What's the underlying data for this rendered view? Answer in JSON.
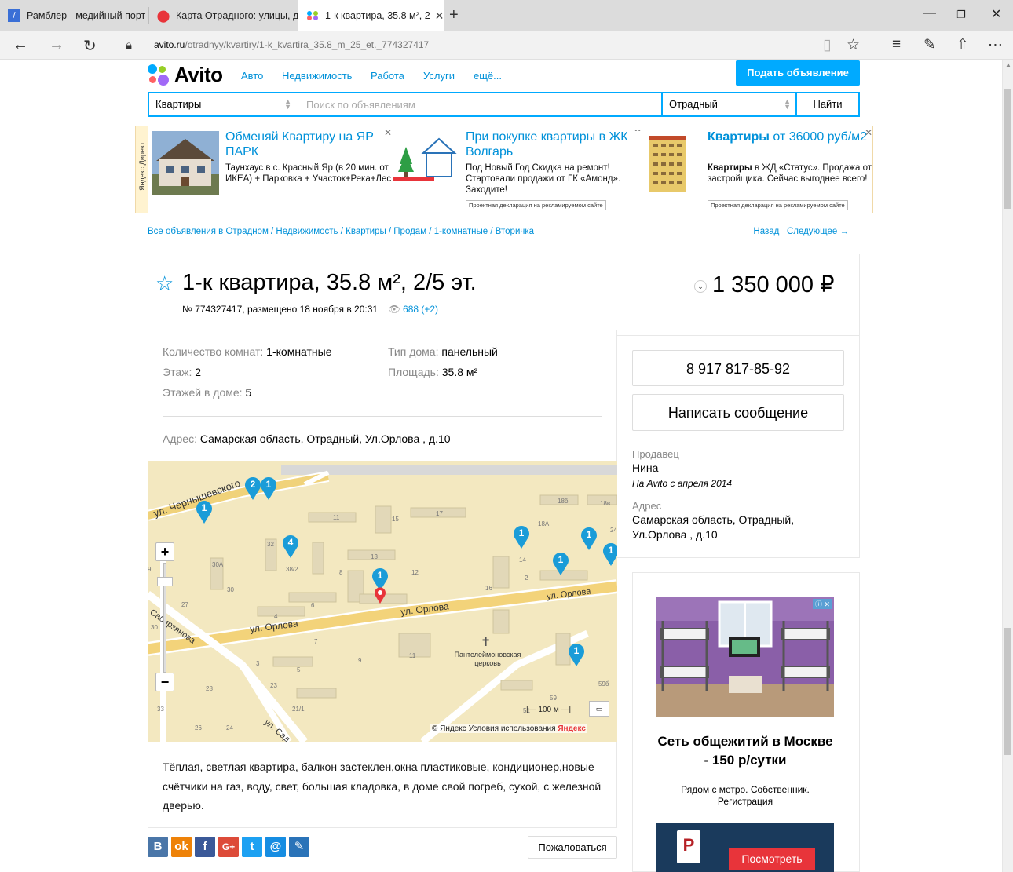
{
  "browser": {
    "tabs": [
      {
        "title": "Рамблер - медийный порт",
        "active": false
      },
      {
        "title": "Карта Отрадного: улицы, д",
        "active": false
      },
      {
        "title": "1-к квартира, 35.8 м², 2",
        "active": true
      }
    ],
    "url_domain": "avito.ru",
    "url_path": "/otradnyy/kvartiry/1-k_kvartira_35.8_m_25_et._774327417"
  },
  "header": {
    "logo": "Avito",
    "nav": [
      "Авто",
      "Недвижимость",
      "Работа",
      "Услуги",
      "ещё..."
    ],
    "post_button": "Подать объявление"
  },
  "search": {
    "category": "Квартиры",
    "placeholder": "Поиск по объявлениям",
    "city": "Отрадный",
    "button": "Найти"
  },
  "ads": {
    "label": "Яндекс.Директ",
    "items": [
      {
        "title": "Обменяй Квартиру на ЯР ПАРК",
        "text": "Таунхаус в с. Красный Яр (в 20 мин. от ИКЕА) + Парковка + Участок+Река+Лес",
        "note": ""
      },
      {
        "title": "При покупке квартиры в ЖК Волгарь",
        "text": "Под Новый Год Скидка на ремонт! Стартовали продажи от ГК «Амонд». Заходите!",
        "note": "Проектная декларация на рекламируемом сайте"
      },
      {
        "title_bold": "Квартиры",
        "title": " от 36000 руб/м2",
        "text_bold": "Квартиры",
        "text": " в ЖД «Статус». Продажа от застройщика. Сейчас выгоднее всего!",
        "note": "Проектная декларация на рекламируемом сайте"
      }
    ]
  },
  "breadcrumbs": "Все объявления в Отрадном / Недвижимость / Квартиры / Продам / 1-комнатные / Вторичка",
  "nav_back": "Назад",
  "nav_next": "Следующее →",
  "listing": {
    "title": "1-к квартира, 35.8 м², 2/5 эт.",
    "meta": "№ 774327417, размещено 18 ноября в 20:31",
    "views": "688 (+2)",
    "price": "1 350 000 ₽",
    "params": [
      {
        "label": "Количество комнат:",
        "value": "1-комнатные"
      },
      {
        "label": "Тип дома:",
        "value": "панельный"
      },
      {
        "label": "Этаж:",
        "value": "2"
      },
      {
        "label": "Площадь:",
        "value": "35.8 м²"
      },
      {
        "label": "Этажей в доме:",
        "value": "5"
      }
    ],
    "address_label": "Адрес:",
    "address": "Самарская область, Отрадный, Ул.Орлова , д.10",
    "description": "Тёплая, светлая квартира, балкон застеклен,окна пластиковые, кондиционер,новые счётчики на газ, воду, свет, большая кладовка, в доме свой погреб, сухой, с железной дверью.",
    "report_button": "Пожаловаться"
  },
  "map": {
    "streets": [
      "ул. Чернышевского",
      "ул. Орлова",
      "ул. Орлова",
      "ул. Орлова",
      "Сабирзянова",
      "ул. Сад"
    ],
    "church": "Пантелеймоновская церковь",
    "scale": "100 м",
    "copyright": "© Яндекс",
    "terms": "Условия использования",
    "brand": "Яндекс",
    "house_numbers": [
      "11",
      "15",
      "17",
      "18б",
      "18в",
      "18А",
      "24",
      "32",
      "13",
      "8",
      "12",
      "30А",
      "30",
      "27",
      "4",
      "6",
      "16",
      "9",
      "30",
      "3",
      "7",
      "11",
      "5",
      "9",
      "28",
      "23",
      "21/1",
      "33",
      "26",
      "24",
      "59б",
      "59",
      "51",
      "2",
      "38/2",
      "14"
    ],
    "cluster_counts": [
      "2",
      "1",
      "1",
      "4",
      "1",
      "1",
      "1",
      "1",
      "1",
      "1"
    ]
  },
  "seller": {
    "phone": "8 917 817-85-92",
    "message_button": "Написать сообщение",
    "seller_label": "Продавец",
    "seller_name": "Нина",
    "since": "На Avito с апреля 2014",
    "address_label": "Адрес",
    "address": "Самарская область, Отрадный, Ул.Орлова , д.10"
  },
  "side_ad": {
    "title": "Сеть общежитий в Москве - 150 р/сутки",
    "text": "Рядом с метро. Собственник. Регистрация",
    "button": "Посмотреть"
  },
  "colors": {
    "accent": "#00aaff",
    "link": "#0091d9",
    "pin": "#1a9cd8",
    "pin_red": "#e8343a"
  }
}
